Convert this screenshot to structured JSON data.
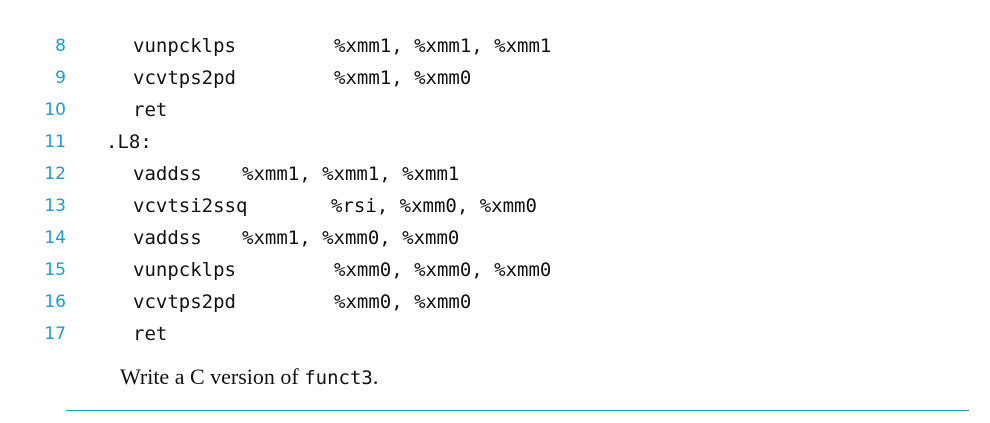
{
  "listing": [
    {
      "num": "8",
      "mnemonic": "vunpcklps",
      "operands": "%xmm1, %xmm1, %xmm1"
    },
    {
      "num": "9",
      "mnemonic": "vcvtps2pd",
      "operands": "%xmm1, %xmm0"
    },
    {
      "num": "10",
      "mnemonic": "ret",
      "operands": ""
    },
    {
      "num": "11",
      "label": ".L8:"
    },
    {
      "num": "12",
      "mnemonic": "vaddss",
      "operands": "%xmm1, %xmm1, %xmm1"
    },
    {
      "num": "13",
      "mnemonic": "vcvtsi2ssq",
      "operands": "%rsi, %xmm0, %xmm0"
    },
    {
      "num": "14",
      "mnemonic": "vaddss",
      "operands": "%xmm1, %xmm0, %xmm0"
    },
    {
      "num": "15",
      "mnemonic": "vunpcklps",
      "operands": "%xmm0, %xmm0, %xmm0"
    },
    {
      "num": "16",
      "mnemonic": "vcvtps2pd",
      "operands": "%xmm0, %xmm0"
    },
    {
      "num": "17",
      "mnemonic": "ret",
      "operands": ""
    }
  ],
  "question": {
    "prefix": "Write a C version of ",
    "code": "funct3",
    "suffix": "."
  },
  "colors": {
    "line_number": "#1a9ec8",
    "rule": "#1a9ec8",
    "text": "#111111"
  }
}
